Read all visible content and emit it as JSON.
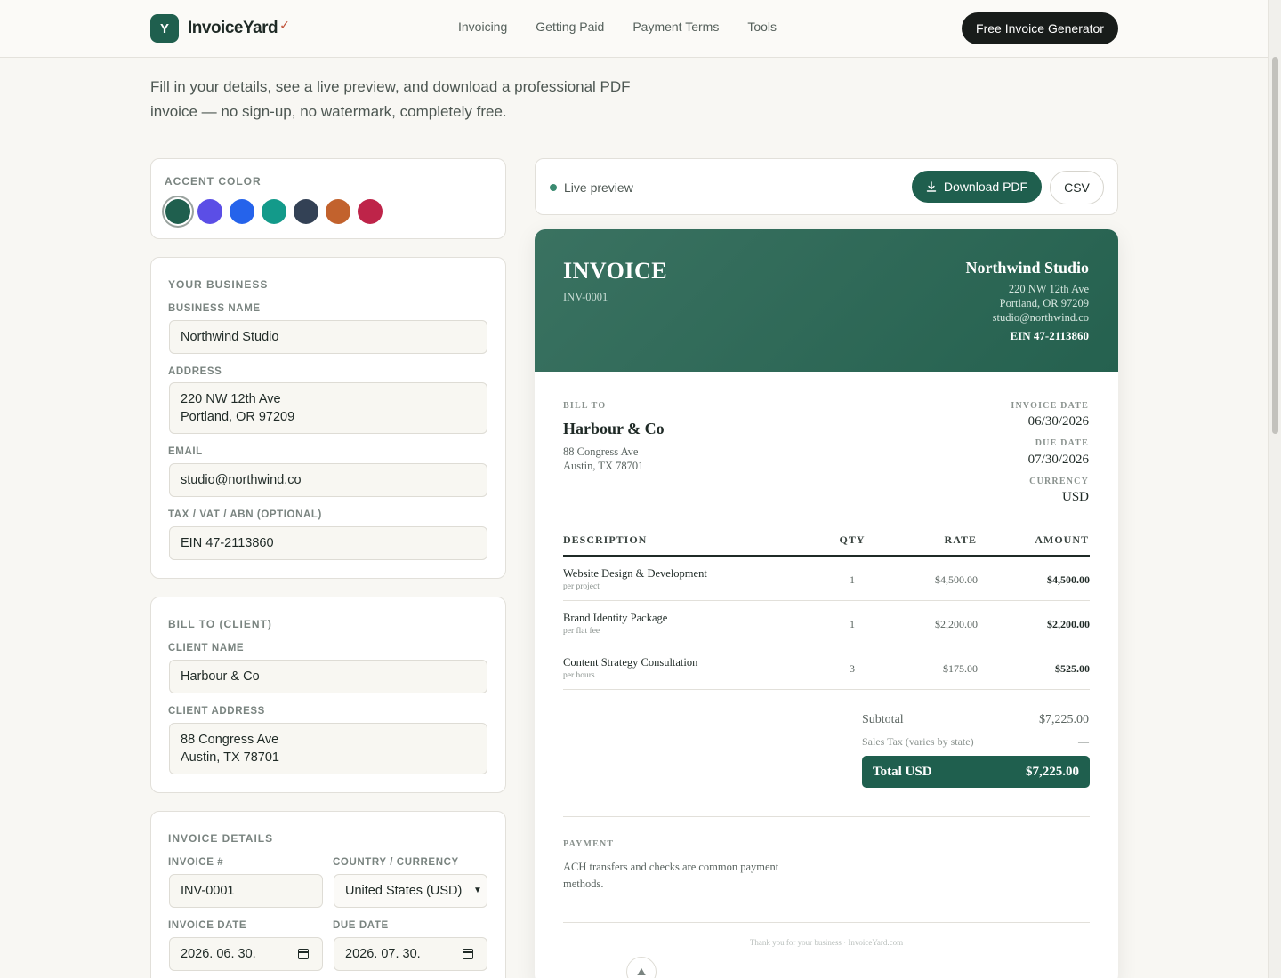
{
  "header": {
    "logo_mark": "Y",
    "logo_text": "InvoiceYard",
    "nav": [
      "Invoicing",
      "Getting Paid",
      "Payment Terms",
      "Tools"
    ],
    "cta": "Free Invoice Generator"
  },
  "intro": "Fill in your details, see a live preview, and download a professional PDF invoice — no sign-up, no watermark, completely free.",
  "accent": {
    "title": "ACCENT COLOR",
    "colors": [
      "#1f5f4e",
      "#5b4ee6",
      "#2563eb",
      "#139a8a",
      "#334155",
      "#c2622d",
      "#be2449"
    ],
    "selected": "#1f5f4e"
  },
  "business": {
    "title": "YOUR BUSINESS",
    "name_label": "BUSINESS NAME",
    "name": "Northwind Studio",
    "address_label": "ADDRESS",
    "address_line1": "220 NW 12th Ave",
    "address_line2": "Portland, OR 97209",
    "email_label": "EMAIL",
    "email": "studio@northwind.co",
    "tax_label": "TAX / VAT / ABN (OPTIONAL)",
    "tax": "EIN 47-2113860"
  },
  "client": {
    "title": "BILL TO (CLIENT)",
    "name_label": "CLIENT NAME",
    "name": "Harbour & Co",
    "address_label": "CLIENT ADDRESS",
    "address_line1": "88 Congress Ave",
    "address_line2": "Austin, TX 78701"
  },
  "details": {
    "title": "INVOICE DETAILS",
    "number_label": "INVOICE #",
    "number": "INV-0001",
    "country_label": "COUNTRY / CURRENCY",
    "country": "United States (USD)",
    "date_label": "INVOICE DATE",
    "date": "2026. 06. 30.",
    "due_label": "DUE DATE",
    "due": "2026. 07. 30."
  },
  "preview_bar": {
    "live": "Live preview",
    "download": "Download PDF",
    "csv": "CSV"
  },
  "invoice": {
    "title": "INVOICE",
    "number": "INV-0001",
    "biz_name": "Northwind Studio",
    "biz_address1": "220 NW 12th Ave",
    "biz_address2": "Portland, OR 97209",
    "biz_email": "studio@northwind.co",
    "biz_ein": "EIN 47-2113860",
    "bill_to_cap": "BILL TO",
    "client_name": "Harbour & Co",
    "client_address1": "88 Congress Ave",
    "client_address2": "Austin, TX 78701",
    "date_cap": "INVOICE DATE",
    "date": "06/30/2026",
    "due_cap": "DUE DATE",
    "due": "07/30/2026",
    "currency_cap": "CURRENCY",
    "currency": "USD",
    "columns": [
      "DESCRIPTION",
      "QTY",
      "RATE",
      "AMOUNT"
    ],
    "items": [
      {
        "desc": "Website Design & Development",
        "unit": "per project",
        "qty": "1",
        "rate": "$4,500.00",
        "amount": "$4,500.00"
      },
      {
        "desc": "Brand Identity Package",
        "unit": "per flat fee",
        "qty": "1",
        "rate": "$2,200.00",
        "amount": "$2,200.00"
      },
      {
        "desc": "Content Strategy Consultation",
        "unit": "per hours",
        "qty": "3",
        "rate": "$175.00",
        "amount": "$525.00"
      }
    ],
    "subtotal_label": "Subtotal",
    "subtotal": "$7,225.00",
    "tax_label": "Sales Tax (varies by state)",
    "tax": "—",
    "total_label": "Total USD",
    "total": "$7,225.00",
    "payment_cap": "PAYMENT",
    "payment_text": "ACH transfers and checks are common payment methods.",
    "footer": "Thank you for your business · InvoiceYard.com"
  }
}
